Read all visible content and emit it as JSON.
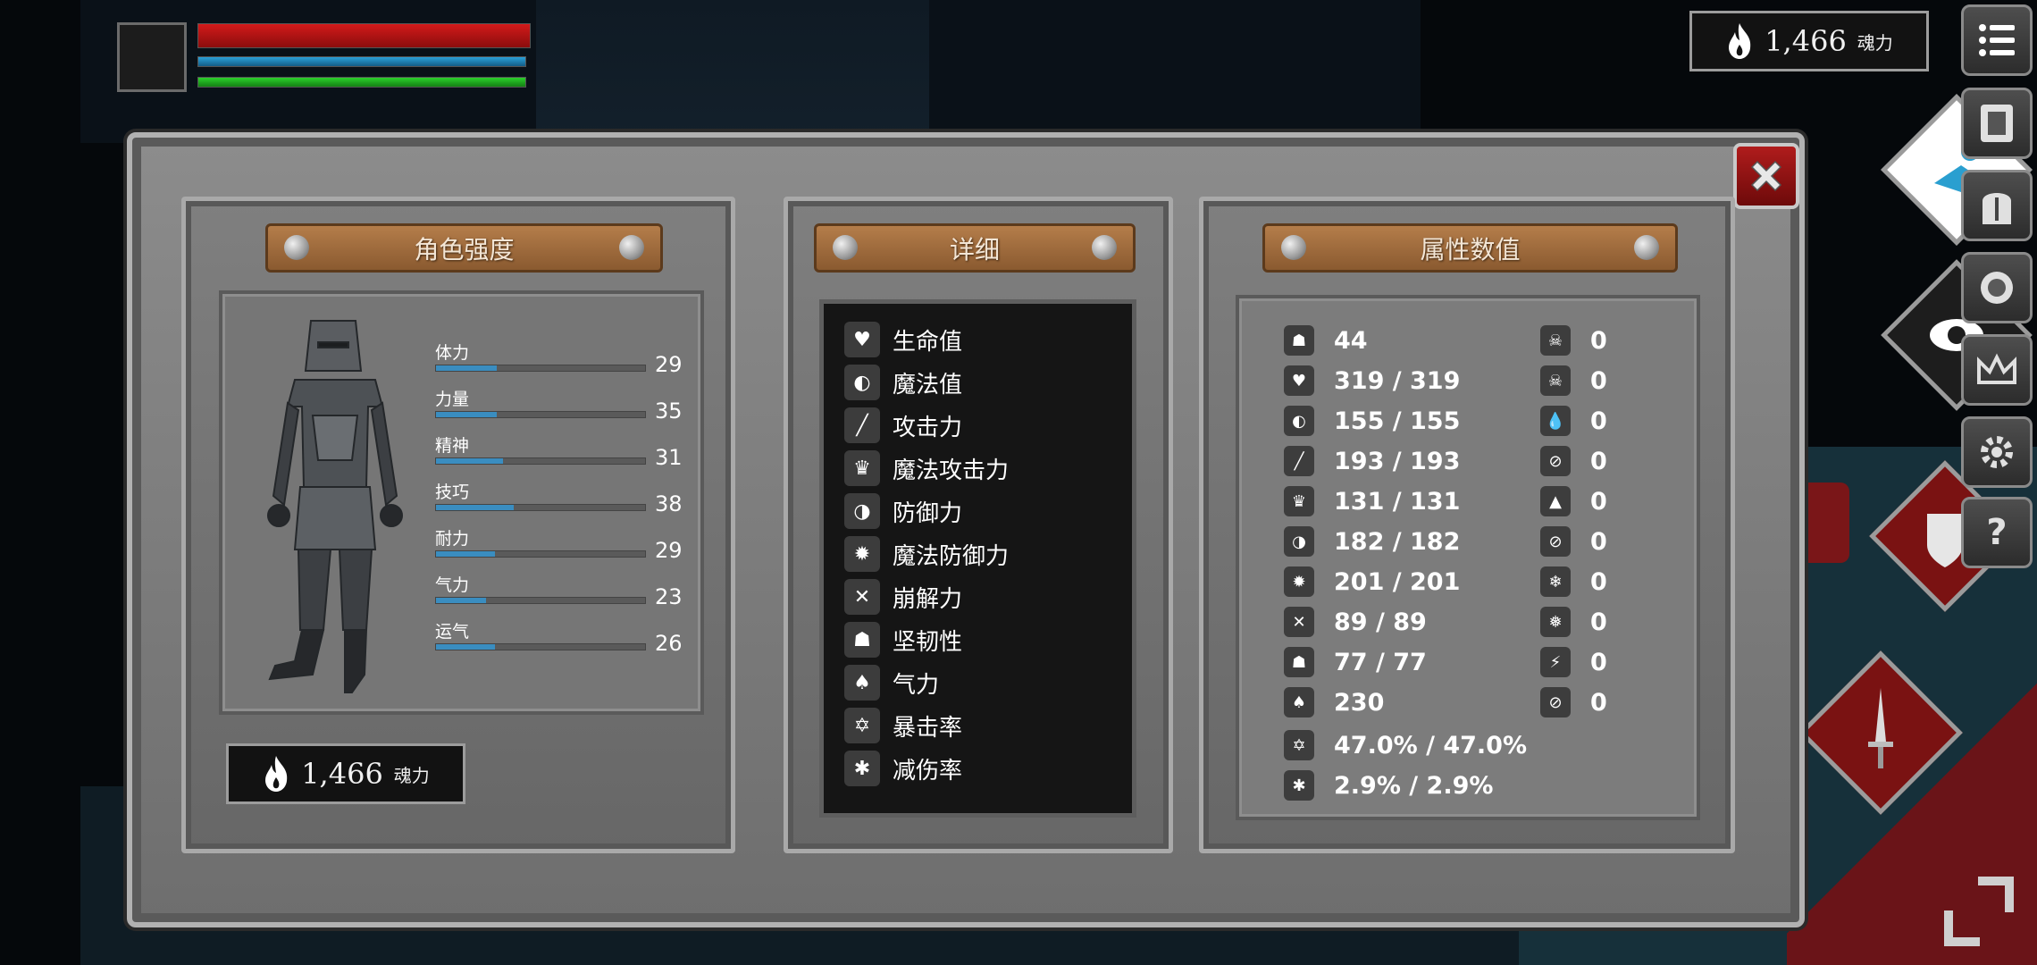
{
  "hud": {
    "soul_amount": "1,466",
    "soul_unit": "魂力"
  },
  "character_panel": {
    "title": "角色强度",
    "stats": [
      {
        "label": "体力",
        "value": "29",
        "fill": 0.29
      },
      {
        "label": "力量",
        "value": "35",
        "fill": 0.29
      },
      {
        "label": "精神",
        "value": "31",
        "fill": 0.32
      },
      {
        "label": "技巧",
        "value": "38",
        "fill": 0.37
      },
      {
        "label": "耐力",
        "value": "29",
        "fill": 0.28
      },
      {
        "label": "气力",
        "value": "23",
        "fill": 0.24
      },
      {
        "label": "运气",
        "value": "26",
        "fill": 0.28
      }
    ],
    "soul_amount": "1,466",
    "soul_unit": "魂力"
  },
  "detail_panel": {
    "title": "详细",
    "rows": [
      {
        "icon": "heart-icon",
        "label": "生命值"
      },
      {
        "icon": "head-icon",
        "label": "魔法值"
      },
      {
        "icon": "sword-icon",
        "label": "攻击力"
      },
      {
        "icon": "magic-book-icon",
        "label": "魔法攻击力"
      },
      {
        "icon": "shield-icon",
        "label": "防御力"
      },
      {
        "icon": "magic-shield-icon",
        "label": "魔法防御力"
      },
      {
        "icon": "break-icon",
        "label": "崩解力"
      },
      {
        "icon": "helmet-icon",
        "label": "坚韧性"
      },
      {
        "icon": "lungs-icon",
        "label": "气力"
      },
      {
        "icon": "star-burst-icon",
        "label": "暴击率"
      },
      {
        "icon": "guard-shield-icon",
        "label": "减伤率"
      }
    ]
  },
  "attribute_panel": {
    "title": "属性数值",
    "left": [
      {
        "icon": "helmet-level-icon",
        "value": "44"
      },
      {
        "icon": "heart-icon",
        "value": "319 / 319"
      },
      {
        "icon": "head-icon",
        "value": "155 / 155"
      },
      {
        "icon": "sword-icon",
        "value": "193 / 193"
      },
      {
        "icon": "magic-book-icon",
        "value": "131 / 131"
      },
      {
        "icon": "shield-icon",
        "value": "182 / 182"
      },
      {
        "icon": "magic-shield-icon",
        "value": "201 / 201"
      },
      {
        "icon": "break-icon",
        "value": "89 / 89"
      },
      {
        "icon": "helmet-icon",
        "value": "77 / 77"
      },
      {
        "icon": "lungs-icon",
        "value": "230"
      },
      {
        "icon": "star-burst-icon",
        "value": "47.0% / 47.0%"
      },
      {
        "icon": "guard-shield-icon",
        "value": "2.9% / 2.9%"
      }
    ],
    "right": [
      {
        "icon": "skull-icon",
        "value": "0"
      },
      {
        "icon": "skull-slash-icon",
        "value": "0"
      },
      {
        "icon": "drop-icon",
        "value": "0"
      },
      {
        "icon": "drop-slash-icon",
        "value": "0"
      },
      {
        "icon": "fire-icon",
        "value": "0"
      },
      {
        "icon": "fire-slash-icon",
        "value": "0"
      },
      {
        "icon": "snowflake-icon",
        "value": "0"
      },
      {
        "icon": "snowflake-slash-icon",
        "value": "0"
      },
      {
        "icon": "lightning-icon",
        "value": "0"
      },
      {
        "icon": "lightning-slash-icon",
        "value": "0"
      }
    ]
  },
  "colors": {
    "hp": "#c81818",
    "mp": "#2294cc",
    "stamina": "#22c022",
    "stat_fill": "#3a8dc0",
    "close_red": "#9e1515",
    "plank": "#a06a3a"
  },
  "side_buttons": [
    "menu-icon",
    "character-card-icon",
    "helmet-button-icon",
    "orb-icon",
    "crown-icon",
    "gear-icon",
    "help-icon"
  ]
}
